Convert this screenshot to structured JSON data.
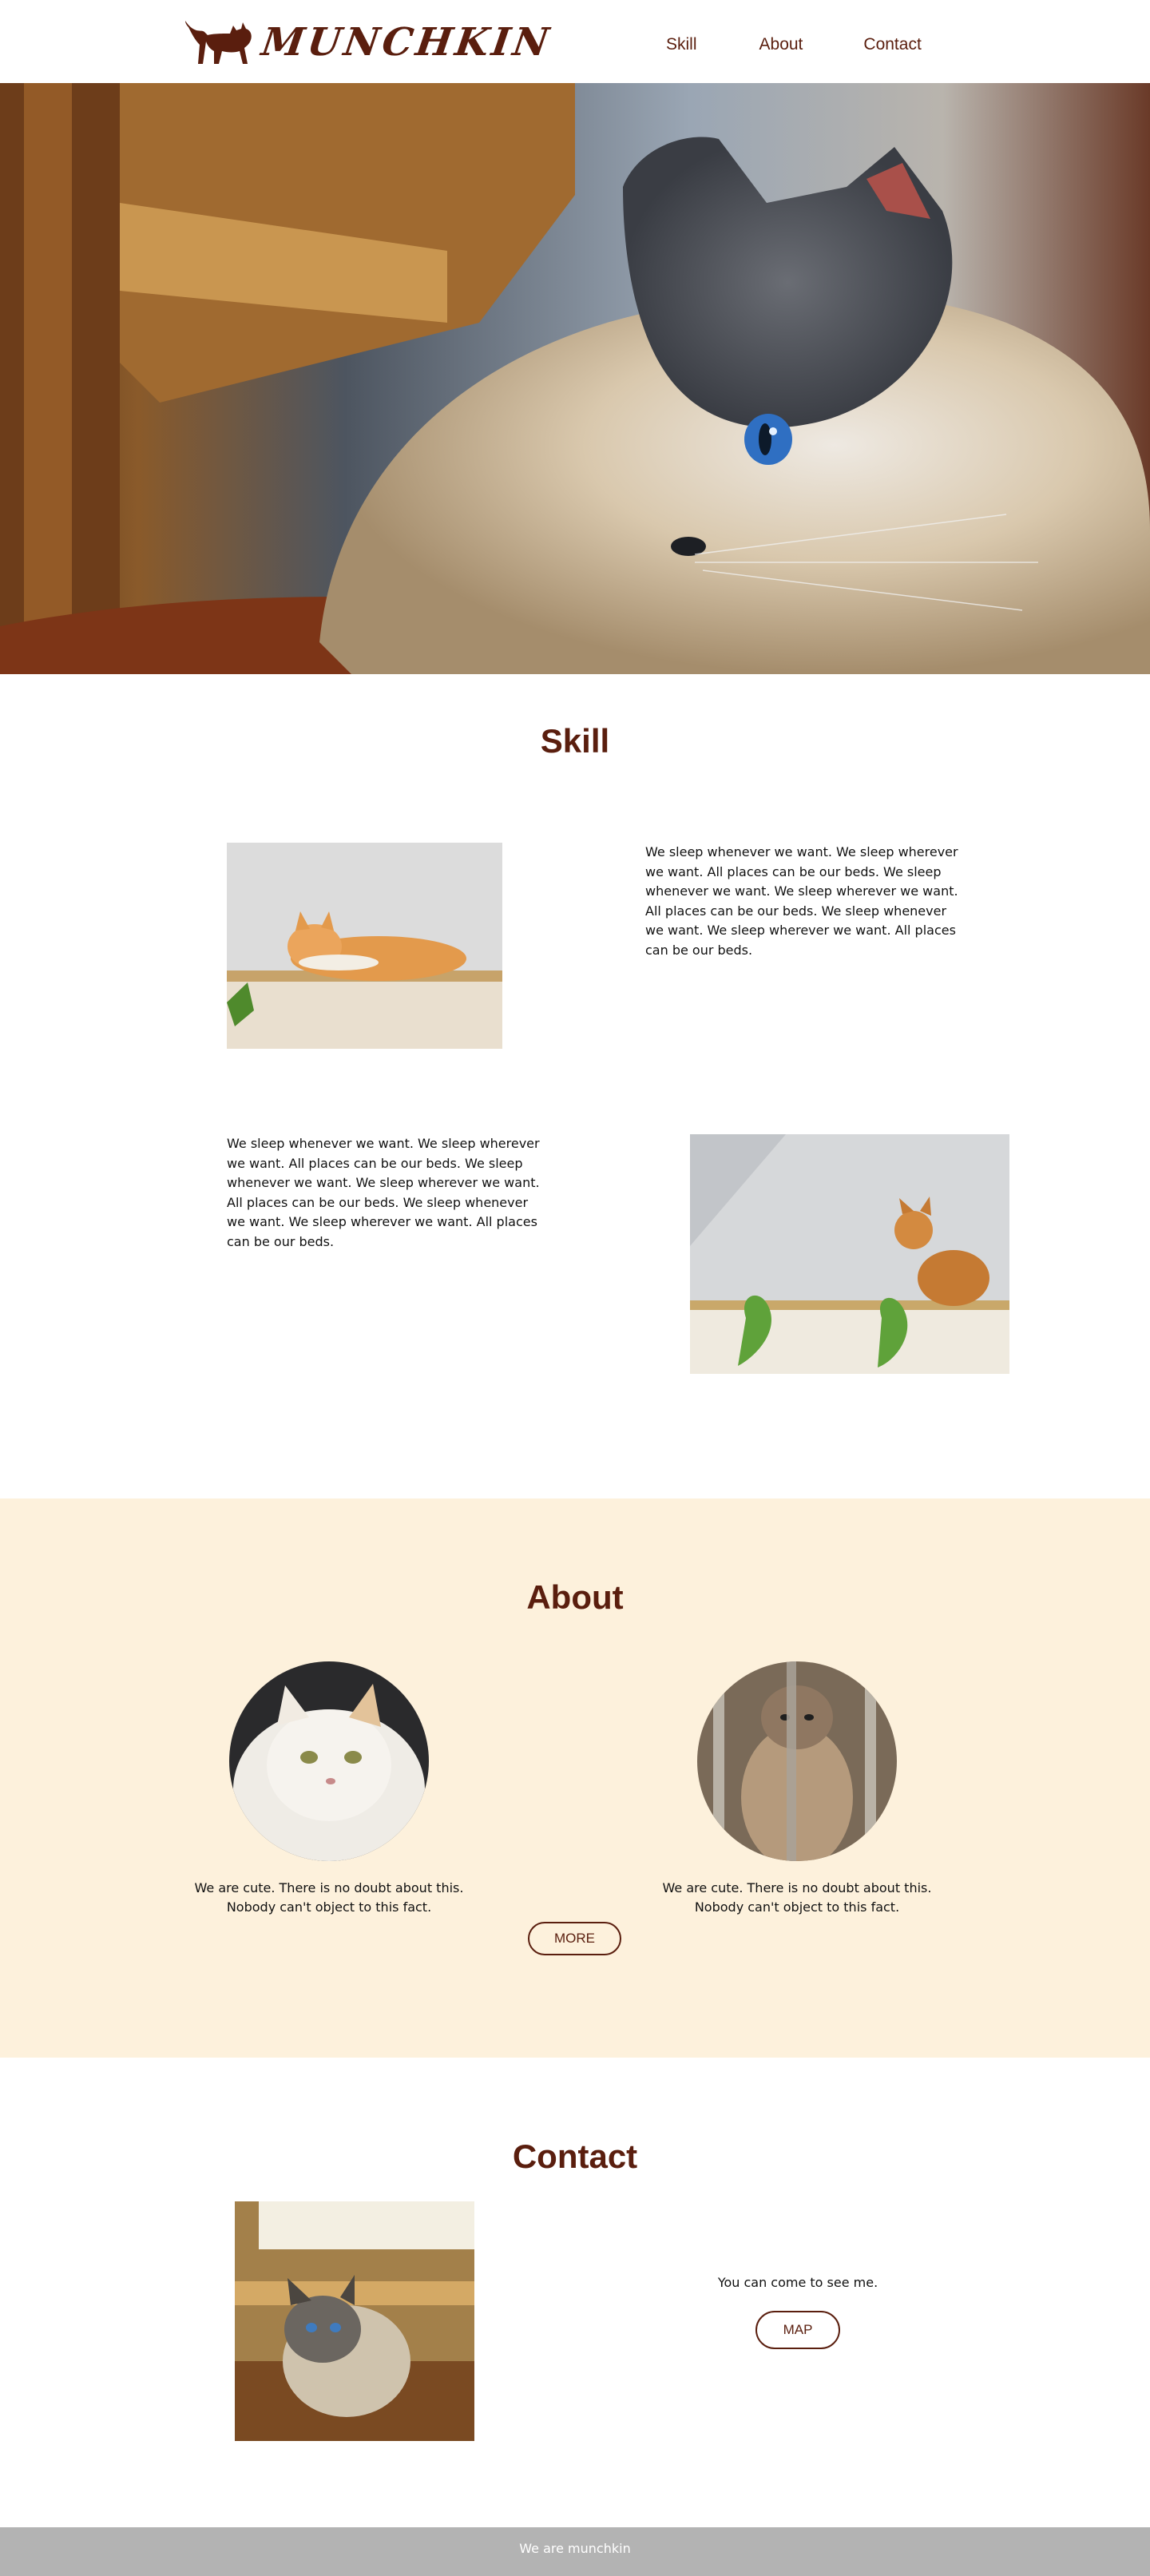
{
  "header": {
    "brand": "MUNCHKIN",
    "nav": [
      "Skill",
      "About",
      "Contact"
    ]
  },
  "skill": {
    "title": "Skill",
    "text1": "We sleep whenever we want. We sleep wherever we want. All places can be our beds. We sleep whenever we want. We sleep wherever we want. All places can be our beds. We sleep whenever we want. We sleep wherever we want. All places can be our beds.",
    "text2": "We sleep whenever we want. We sleep wherever we want. All places can be our beds. We sleep whenever we want. We sleep wherever we want. All places can be our beds. We sleep whenever we want. We sleep wherever we want. All places can be our beds."
  },
  "about": {
    "title": "About",
    "caption1_line1": "We are cute. There is no doubt about this.",
    "caption1_line2": "Nobody can't object to this fact.",
    "caption2_line1": "We are cute. There is no doubt about this.",
    "caption2_line2": "Nobody can't object to this fact.",
    "more_label": "MORE"
  },
  "contact": {
    "title": "Contact",
    "text": "You can come to see me.",
    "map_label": "MAP"
  },
  "footer": {
    "text": "We are munchkin"
  },
  "colors": {
    "brand": "#5a1e0e",
    "about_bg": "#fdf1dc",
    "footer_bg": "#b3b3b3"
  }
}
